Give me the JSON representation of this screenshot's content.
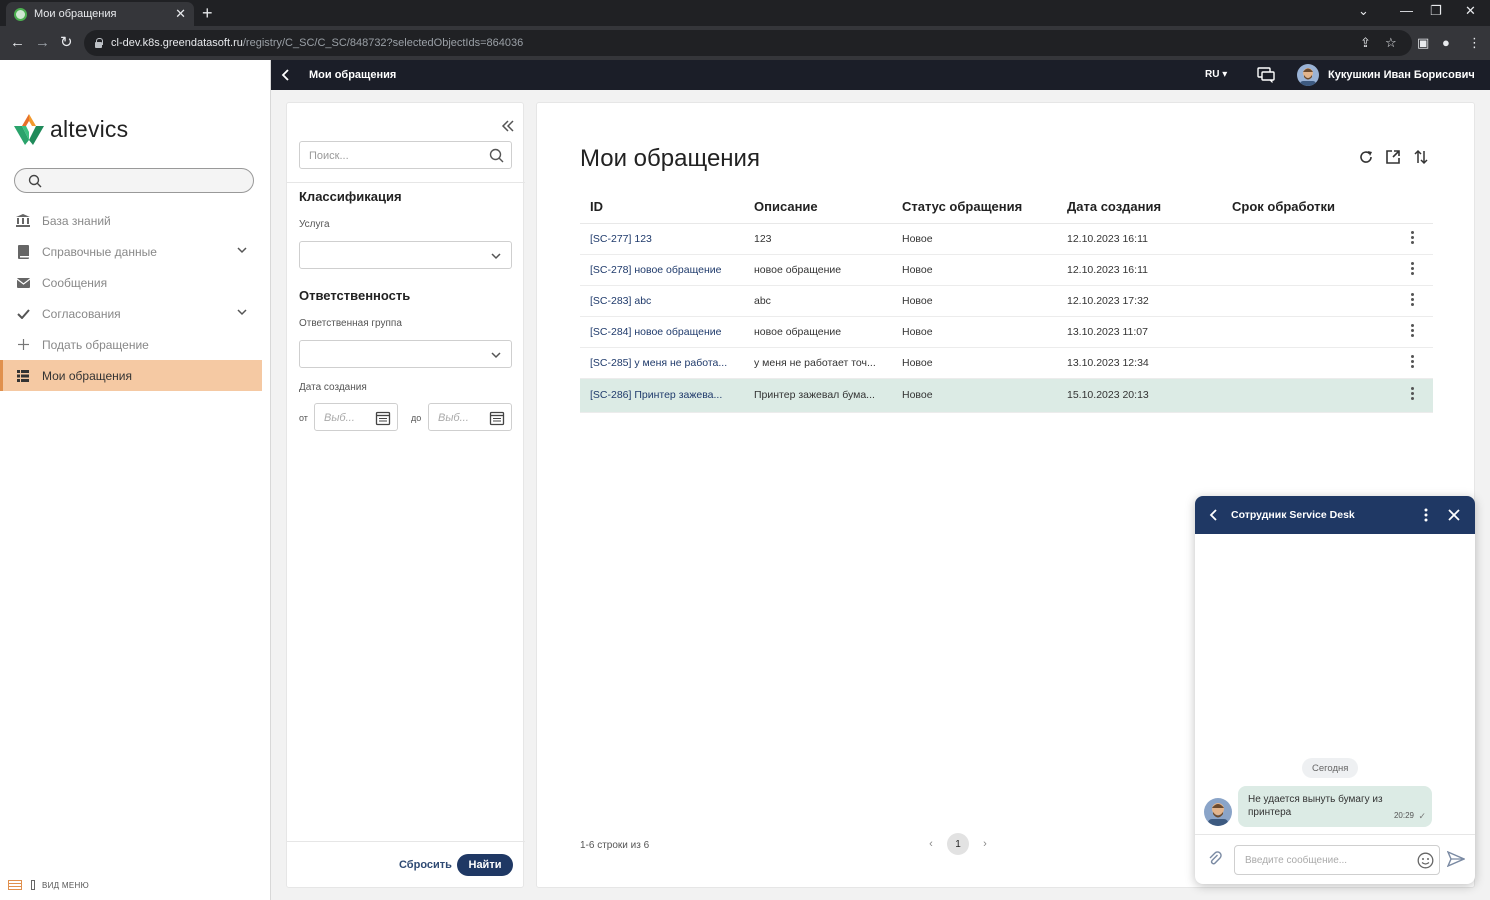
{
  "browser": {
    "tab_title": "Мои обращения",
    "url_host": "cl-dev.k8s.greendatasoft.ru",
    "url_path": "/registry/C_SC/C_SC/848732?selectedObjectIds=864036"
  },
  "sidebar": {
    "logo_text": "altevics",
    "items": [
      {
        "label": "База знаний",
        "icon": "bank-icon"
      },
      {
        "label": "Справочные данные",
        "icon": "book-icon"
      },
      {
        "label": "Сообщения",
        "icon": "envelope-icon"
      },
      {
        "label": "Согласования",
        "icon": "check-icon"
      },
      {
        "label": "Подать обращение",
        "icon": "plus-icon"
      },
      {
        "label": "Мои обращения",
        "icon": "list-icon"
      }
    ],
    "footer_label": "ВИД МЕНЮ"
  },
  "header": {
    "title": "Мои обращения",
    "lang": "RU",
    "user_name": "Кукушкин Иван Борисович"
  },
  "filter": {
    "search_placeholder": "Поиск...",
    "section_classification": "Классификация",
    "service_label": "Услуга",
    "section_responsibility": "Ответственность",
    "group_label": "Ответственная группа",
    "date_label": "Дата создания",
    "from_label": "от",
    "to_label": "до",
    "date_placeholder": "Выб...",
    "reset_label": "Сбросить",
    "find_label": "Найти"
  },
  "main": {
    "title": "Мои обращения",
    "columns": [
      "ID",
      "Описание",
      "Статус обращения",
      "Дата создания",
      "Срок обработки"
    ],
    "rows": [
      {
        "id": "[SC-277] 123",
        "desc": "123",
        "status": "Новое",
        "created": "12.10.2023 16:11",
        "due": ""
      },
      {
        "id": "[SC-278] новое обращение",
        "desc": "новое обращение",
        "status": "Новое",
        "created": "12.10.2023 16:11",
        "due": ""
      },
      {
        "id": "[SC-283] abc",
        "desc": "abc",
        "status": "Новое",
        "created": "12.10.2023 17:32",
        "due": ""
      },
      {
        "id": "[SC-284] новое обращение",
        "desc": "новое обращение",
        "status": "Новое",
        "created": "13.10.2023 11:07",
        "due": ""
      },
      {
        "id": "[SC-285] у меня не работа...",
        "desc": "у меня не работает точ...",
        "status": "Новое",
        "created": "13.10.2023 12:34",
        "due": ""
      },
      {
        "id": "[SC-286] Принтер зажева...",
        "desc": "Принтер зажевал бума...",
        "status": "Новое",
        "created": "15.10.2023 20:13",
        "due": ""
      }
    ],
    "selected_row": 5,
    "pagination_info": "1-6 строки из 6",
    "current_page": "1"
  },
  "chat": {
    "title": "Сотрудник Service Desk",
    "day_label": "Сегодня",
    "message_text": "Не удается вынуть бумагу из принтера",
    "message_time": "20:29",
    "input_placeholder": "Введите сообщение..."
  },
  "colors": {
    "header_bg": "#1b1e28",
    "accent_navy": "#1f3864",
    "active_nav": "#f5c9a3",
    "selected_row": "#dcebe5"
  }
}
